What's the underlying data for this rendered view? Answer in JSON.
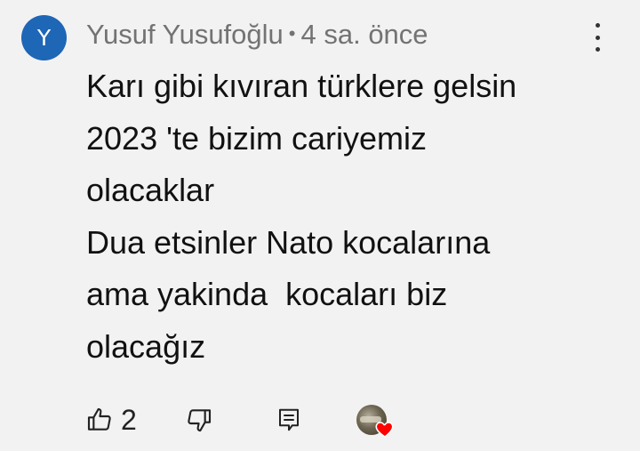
{
  "comment": {
    "avatar_letter": "Y",
    "avatar_color": "#1e66b6",
    "author": "Yusuf Yusufoğlu",
    "separator": "•",
    "time": "4 sa. önce",
    "menu_icon": "more-vert-icon",
    "lines": [
      "Karı gibi kıvıran türklere gelsin",
      "2023 'te bizim cariyemiz",
      "olacaklar",
      "Dua etsinler Nato kocalarına",
      "ama yakinda  kocaları biz",
      "olacağız"
    ],
    "actions": {
      "like_icon": "thumb-up-icon",
      "like_count": "2",
      "dislike_icon": "thumb-down-icon",
      "reply_icon": "reply-icon",
      "creator_heart_icon": "creator-heart-icon",
      "heart_color": "#ff0000"
    }
  }
}
